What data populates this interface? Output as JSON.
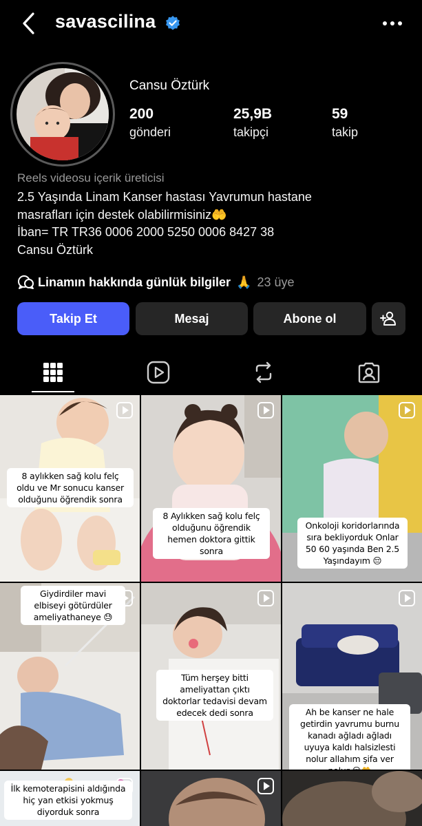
{
  "header": {
    "username": "savascilina",
    "verified_icon": "verified-badge-icon",
    "back_icon": "chevron-left-icon",
    "more_icon": "more-horizontal-icon"
  },
  "profile": {
    "full_name": "Cansu Öztürk",
    "stats": [
      {
        "value": "200",
        "label": "gönderi"
      },
      {
        "value": "25,9B",
        "label": "takipçi"
      },
      {
        "value": "59",
        "label": "takip"
      }
    ],
    "category": "Reels videosu içerik üreticisi",
    "bio_lines": [
      "2.5 Yaşında Linam Kanser hastası Yavrumun hastane",
      "masrafları için destek olabilirmisiniz🤲",
      "İban= TR TR36 0006 2000 5250 0006 8427 38",
      "Cansu Öztürk"
    ]
  },
  "channel": {
    "name": "Linamın hakkında günlük bilgiler",
    "emoji": "🙏",
    "members": "23 üye"
  },
  "actions": {
    "follow": "Takip Et",
    "message": "Mesaj",
    "subscribe": "Abone ol",
    "add_person_icon": "add-person-icon"
  },
  "tabs": [
    {
      "icon": "grid-icon",
      "active": true
    },
    {
      "icon": "reels-icon",
      "active": false
    },
    {
      "icon": "reposts-icon",
      "active": false
    },
    {
      "icon": "tagged-icon",
      "active": false
    }
  ],
  "posts": [
    {
      "caption": "8 aylıkken sağ kolu felç oldu ve Mr sonucu kanser olduğunu öğrendik sonra"
    },
    {
      "caption": "8 Aylıkken sağ kolu felç olduğunu öğrendik hemen doktora gittik sonra"
    },
    {
      "caption": "Onkoloji koridorlarında sıra bekliyorduk Onlar 50 60 yaşında Ben 2.5 Yaşındayım 😔"
    },
    {
      "caption": "Giydirdiler mavi elbiseyi götürdüler ameliyathaneye 😓"
    },
    {
      "caption": "Tüm herşey bitti ameliyattan çıktı doktorlar tedavisi devam edecek dedi sonra"
    },
    {
      "caption": "Ah be kanser ne hale getirdin yavrumu burnu kanadı ağladı ağladı uyuya kaldı halsizlesti nolur allahım şifa ver nolur 😔🤲"
    },
    {
      "caption": "İlk kemoterapisini aldığında hiç yan etkisi yokmuş diyorduk sonra"
    },
    {
      "caption": ""
    },
    {
      "caption": ""
    }
  ],
  "colors": {
    "background": "#000000",
    "follow_button": "#4a5df9",
    "secondary_button": "#262626",
    "verified": "#3897f0",
    "muted_text": "#9a9a9a"
  }
}
